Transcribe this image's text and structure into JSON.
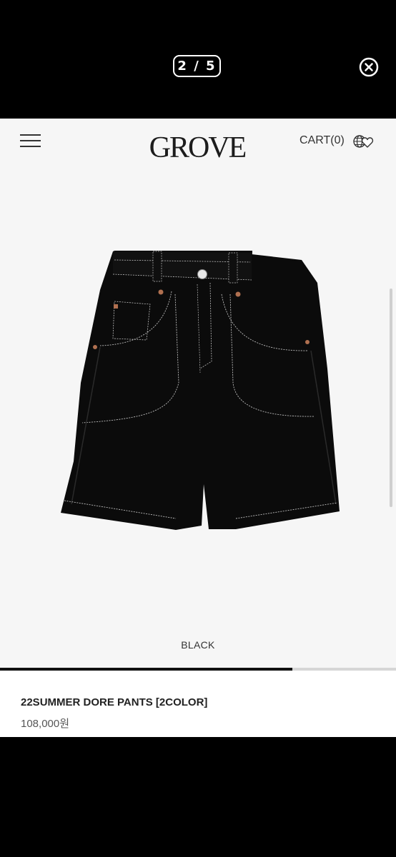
{
  "viewer": {
    "counter": "2 / 5"
  },
  "header": {
    "logo": "GROVE",
    "cart": "CART(0)"
  },
  "product": {
    "color_option": "BLACK",
    "name": "22SUMMER DORE PANTS [2COLOR]",
    "price": "108,000원",
    "image_progress": 0.738
  },
  "icons": [
    "close-icon",
    "hamburger-menu-icon",
    "globe-heart-icon",
    "product-photo"
  ]
}
